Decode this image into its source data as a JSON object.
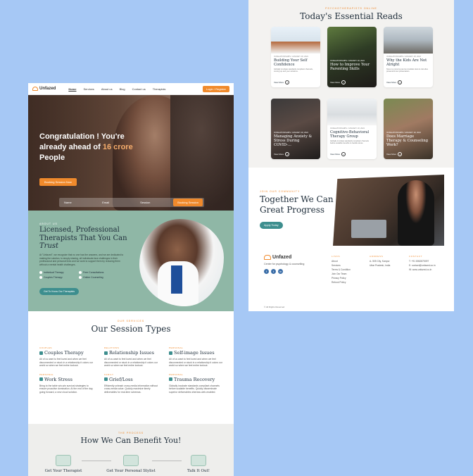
{
  "brand": {
    "name": "Unfazed",
    "tagline": "Center for psychology & counselling"
  },
  "nav": {
    "links": [
      "Home",
      "Services",
      "About us",
      "Blog",
      "Contact us",
      "Therapists"
    ],
    "cta": "Login / Register"
  },
  "hero": {
    "heading_line1": "Congratulation ! You're",
    "heading_line2_pre": "already ahead of",
    "heading_line2_accent": "16 crore",
    "heading_line3": "People",
    "cta": "Booking Session Now",
    "form": {
      "name": "Name",
      "email": "Email",
      "session": "Session",
      "submit": "Booking Session"
    }
  },
  "licensed": {
    "eyebrow": "ABOUT US",
    "heading": "Licensed, Professional Therapists That You Can",
    "heading_em": "Trust",
    "body": "At \"Unfazed\", we recognize that no one has the answers, and we are dedicated to making the solution, to simply sharing, all individuals face challenges in their professional and personal lives and we work to support them by reducing them without a mental health challenges.",
    "checks": [
      "Individual Therapy",
      "Free Consultations",
      "Couples Therapy",
      "Online Counseling"
    ],
    "cta": "Get To Know Our Therapists"
  },
  "services": {
    "eyebrow": "OUR SERVICES",
    "heading": "Our Session Types",
    "items": [
      {
        "tag": "COUPLES",
        "title": "Couples Therapy",
        "desc": "All of us want to feel loved and when we feel disconnected or stuck in a relationship it colors our world so when we feel entire lockout."
      },
      {
        "tag": "RELATIONS",
        "title": "Relationship Issues",
        "desc": "All of us want to feel loved and when we feel disconnected or stuck in a relationship it colors our world so when we feel entire lockout."
      },
      {
        "tag": "PERSONAL",
        "title": "Self-image Issues",
        "desc": "All of us want to feel loved and when we feel disconnected or stuck in a relationship it colors our world so when we feel entire lockout."
      },
      {
        "tag": "PERSONAL",
        "title": "Work Stress",
        "desc": "Bring to the table win-win survival strategies to ensure proactive domination. At the end of the day, going forward, a new cloud solution."
      },
      {
        "tag": "FAMILY",
        "title": "Grief/Loss",
        "desc": "Efficiently unleash cross-media information without cross-media value. Quickly maximize timely deliverables for real-time schemas."
      },
      {
        "tag": "PERSONAL",
        "title": "Trauma Recovery",
        "desc": "Globally incubate standards compliant channels before scalable benefits. Quickly disseminate superior deliverables whereas web-enabled."
      }
    ]
  },
  "process": {
    "eyebrow": "THE PROCESS",
    "heading": "How We Can Benefit You!",
    "steps": [
      "Get Your Therapist",
      "Get Your Personal Stylist",
      "Talk It Out!"
    ]
  },
  "reads": {
    "eyebrow": "PSYCHOTHERAPISTS ONLINE",
    "heading": "Today's Essential Reads",
    "more_label": "View More",
    "cards": [
      {
        "meta": "IN RELATIONSHIPS / JANUARY 18, 2024",
        "title": "Building Your Self Confidence",
        "desc": "Globally incubate standards compliant channels, coming up and your solutions."
      },
      {
        "meta": "IN RELATIONSHIPS / JANUARY 18, 2024",
        "title": "How to Improve Your Parenting Skills",
        "desc": ""
      },
      {
        "meta": "IN RELATIONSHIPS / JANUARY 18, 2024",
        "title": "Why the Kids Are Not Alright",
        "desc": "Nous ne prenons pas les résultats dans le ciel elles présentent leur présentation."
      },
      {
        "meta": "IN RELATIONSHIPS / JANUARY 18, 2024",
        "title": "Managing Anxiety & Stress During COVID-...",
        "desc": ""
      },
      {
        "meta": "IN RELATIONSHIPS / JANUARY 18, 2024",
        "title": "Cognitive-Behavioral Therapy Group",
        "desc": "Globally incubate standards compliant channels before scalable benefits to handle stress."
      },
      {
        "meta": "IN RELATIONSHIPS / JANUARY 18, 2024",
        "title": "Does Marriage Therapy & Counseling Work?",
        "desc": ""
      }
    ]
  },
  "together": {
    "eyebrow": "JOIN OUR COMMUNITY",
    "heading": "Together We Can Make Great Progress",
    "cta": "Apply Today"
  },
  "footer": {
    "links_heading": "LINKS",
    "links": [
      "About",
      "Services",
      "Terms & Condition",
      "Join Our Team",
      "Privacy Policy",
      "Refund Policy"
    ],
    "address_heading": "ADDRESS",
    "address": [
      "A- 505 City, Kanpur",
      "Uttar Pradesh, India"
    ],
    "contact_heading": "CONTACT",
    "contact": [
      "T: +91 8062875097",
      "E: contact@unfazed.co.in",
      "W: www.unfazed.co.in"
    ],
    "social": [
      "f",
      "t",
      "in"
    ],
    "copyright": "© All Rights Reserved"
  },
  "colors": {
    "accent": "#f08a2c",
    "teal": "#3d8e8e",
    "sage": "#8fb7a6",
    "background": "#a6c8f5"
  }
}
